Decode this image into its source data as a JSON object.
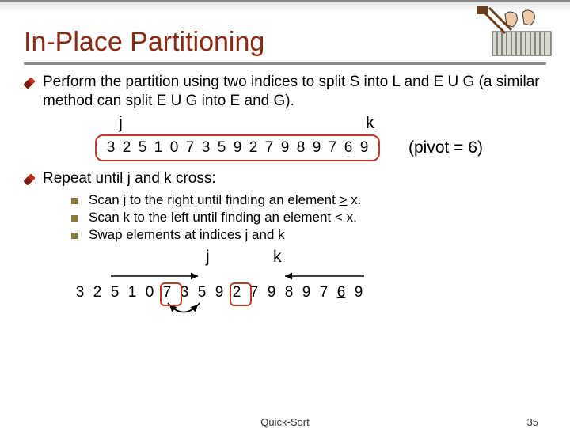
{
  "title": "In-Place Partitioning",
  "bullet1": "Perform the partition using two indices to split S into L and E U G (a similar method can split E U G into E and G).",
  "j_label": "j",
  "k_label": "k",
  "array1": [
    "3",
    "2",
    "5",
    "1",
    "0",
    "7",
    "3",
    "5",
    "9",
    "2",
    "7",
    "9",
    "8",
    "9",
    "7",
    "6",
    "9"
  ],
  "pivot_note": "(pivot = 6)",
  "bullet2": "Repeat until j and k cross:",
  "sub1_a": "Scan j to the right until finding an element ",
  "sub1_b": ">",
  "sub1_c": " x.",
  "sub2": "Scan k to the left until finding an element < x.",
  "sub3": "Swap elements at indices j and k",
  "array2": [
    "3",
    "2",
    "5",
    "1",
    "0",
    "7",
    "3",
    "5",
    "9",
    "2",
    "7",
    "9",
    "8",
    "9",
    "7",
    "6",
    "9"
  ],
  "footer_center": "Quick-Sort",
  "footer_right": "35"
}
